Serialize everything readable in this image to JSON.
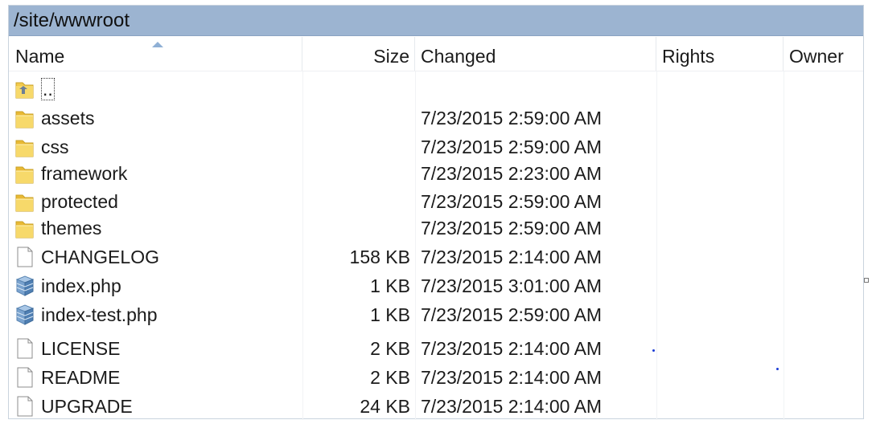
{
  "path": "/site/wwwroot",
  "columns": {
    "name": "Name",
    "size": "Size",
    "changed": "Changed",
    "rights": "Rights",
    "owner": "Owner"
  },
  "rows": [
    {
      "type": "parent",
      "name": "..",
      "size": "",
      "changed": ""
    },
    {
      "type": "folder",
      "name": "assets",
      "size": "",
      "changed": "7/23/2015 2:59:00 AM"
    },
    {
      "type": "folder",
      "name": "css",
      "size": "",
      "changed": "7/23/2015 2:59:00 AM"
    },
    {
      "type": "folder",
      "name": "framework",
      "size": "",
      "changed": "7/23/2015 2:23:00 AM"
    },
    {
      "type": "folder",
      "name": "protected",
      "size": "",
      "changed": "7/23/2015 2:59:00 AM"
    },
    {
      "type": "folder",
      "name": "themes",
      "size": "",
      "changed": "7/23/2015 2:59:00 AM"
    },
    {
      "type": "file",
      "name": "CHANGELOG",
      "size": "158 KB",
      "changed": "7/23/2015 2:14:00 AM"
    },
    {
      "type": "php",
      "name": "index.php",
      "size": "1 KB",
      "changed": "7/23/2015 3:01:00 AM"
    },
    {
      "type": "php",
      "name": "index-test.php",
      "size": "1 KB",
      "changed": "7/23/2015 2:59:00 AM"
    },
    {
      "type": "file",
      "name": "LICENSE",
      "size": "2 KB",
      "changed": "7/23/2015 2:14:00 AM"
    },
    {
      "type": "file",
      "name": "README",
      "size": "2 KB",
      "changed": "7/23/2015 2:14:00 AM"
    },
    {
      "type": "file",
      "name": "UPGRADE",
      "size": "24 KB",
      "changed": "7/23/2015 2:14:00 AM"
    }
  ],
  "icons": {
    "parent": "folder-up-icon",
    "folder": "folder-icon",
    "file": "file-icon",
    "php": "php-file-icon"
  },
  "colors": {
    "pathbar": "#9cb4d1",
    "folder": "#f2c94c",
    "selection_dot": "#1a3bd6"
  }
}
